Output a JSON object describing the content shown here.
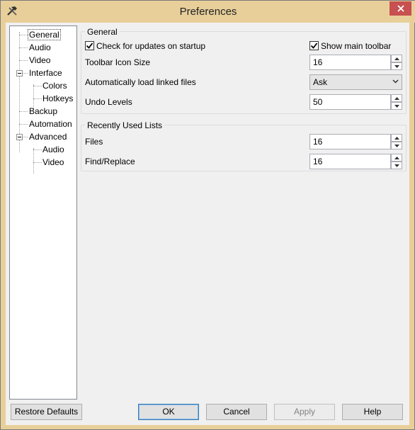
{
  "window": {
    "title": "Preferences"
  },
  "tree": {
    "items": [
      {
        "label": "General",
        "indent": 0,
        "selected": true
      },
      {
        "label": "Audio",
        "indent": 0
      },
      {
        "label": "Video",
        "indent": 0
      },
      {
        "label": "Interface",
        "indent": 0,
        "expandable": true
      },
      {
        "label": "Colors",
        "indent": 1
      },
      {
        "label": "Hotkeys",
        "indent": 1
      },
      {
        "label": "Backup",
        "indent": 0
      },
      {
        "label": "Automation",
        "indent": 0
      },
      {
        "label": "Advanced",
        "indent": 0,
        "expandable": true
      },
      {
        "label": "Audio",
        "indent": 1
      },
      {
        "label": "Video",
        "indent": 1
      }
    ]
  },
  "general": {
    "title": "General",
    "check_updates": {
      "label": "Check for updates on startup",
      "checked": true
    },
    "show_toolbar": {
      "label": "Show main toolbar",
      "checked": true
    },
    "toolbar_icon_size": {
      "label": "Toolbar Icon Size",
      "value": "16"
    },
    "auto_load": {
      "label": "Automatically load linked files",
      "value": "Ask"
    },
    "undo_levels": {
      "label": "Undo Levels",
      "value": "50"
    }
  },
  "recent": {
    "title": "Recently Used Lists",
    "files": {
      "label": "Files",
      "value": "16"
    },
    "find_replace": {
      "label": "Find/Replace",
      "value": "16"
    }
  },
  "buttons": {
    "restore": "Restore Defaults",
    "ok": "OK",
    "cancel": "Cancel",
    "apply": "Apply",
    "help": "Help"
  },
  "colors": {
    "titlebar": "#e8cf9a",
    "close": "#c75050",
    "dialog": "#f0f0f0"
  }
}
